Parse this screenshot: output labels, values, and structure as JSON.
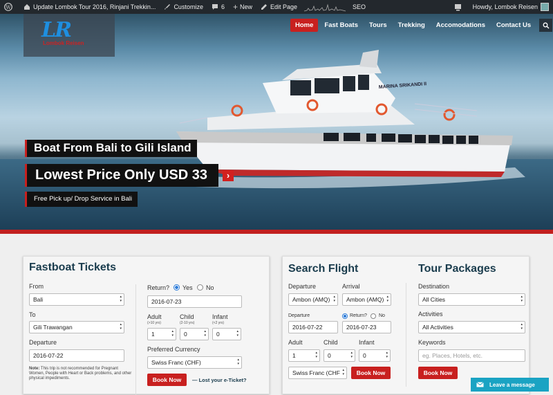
{
  "admin_bar": {
    "site": "Update Lombok Tour 2016, Rinjani Trekkin...",
    "customize": "Customize",
    "comments": "6",
    "new": "New",
    "edit": "Edit Page",
    "seo": "SEO",
    "howdy": "Howdy, Lombok Reisen"
  },
  "logo": {
    "mark": "LR",
    "text": "Lombok Reisen"
  },
  "nav": {
    "items": [
      "Home",
      "Fast Boats",
      "Tours",
      "Trekking",
      "Accomodations",
      "Contact Us"
    ]
  },
  "hero": {
    "caption1": "Boat From Bali to Gili Island",
    "caption2": "Lowest Price Only USD 33",
    "caption3": "Free Pick up/ Drop Service in Bali",
    "boat_name": "MARINA SRIKANDI II"
  },
  "fastboat": {
    "title": "Fastboat Tickets",
    "from_label": "From",
    "from_value": "Bali",
    "to_label": "To",
    "to_value": "Gili Trawangan",
    "departure_label": "Departure",
    "departure_value": "2016-07-22",
    "note_bold": "Note:",
    "note": "This trip is not recommended for Pregnant Women, People with Heart or Back problems, and other physical impediments.",
    "return_label": "Return?",
    "yes": "Yes",
    "no": "No",
    "return_value": "2016-07-23",
    "adult_label": "Adult",
    "adult_sub": "(>10 yrs)",
    "adult_value": "1",
    "child_label": "Child",
    "child_sub": "(2-10 yrs)",
    "child_value": "0",
    "infant_label": "Infant",
    "infant_sub": "(<2 yrs)",
    "infant_value": "0",
    "currency_label": "Preferred Currency",
    "currency_value": "Swiss Franc (CHF)",
    "book": "Book Now",
    "lost": "Lost your e-Ticket?"
  },
  "flight": {
    "title": "Search Flight",
    "departure_label": "Departure",
    "departure_value": "Ambon (AMQ)",
    "arrival_label": "Arrival",
    "arrival_value": "Ambon (AMQ)",
    "date_label": "Departure",
    "date_value": "2016-07-22",
    "return_label": "Return?",
    "no": "No",
    "return_value": "2016-07-23",
    "adult_label": "Adult",
    "adult_value": "1",
    "child_label": "Child",
    "child_value": "0",
    "infant_label": "Infant",
    "infant_value": "0",
    "currency_value": "Swiss Franc (CHF",
    "book": "Book Now"
  },
  "tours": {
    "title": "Tour Packages",
    "destination_label": "Destination",
    "destination_value": "All Cities",
    "activities_label": "Activities",
    "activities_value": "All Activities",
    "keywords_label": "Keywords",
    "keywords_placeholder": "eg. Places, Hotels, etc.",
    "book": "Book Now"
  },
  "chat": {
    "label": "Leave a message"
  },
  "colors": {
    "accent": "#c8201f",
    "admin_bar": "#23282d",
    "title": "#1a3c4d",
    "chat": "#1aa3c3"
  }
}
